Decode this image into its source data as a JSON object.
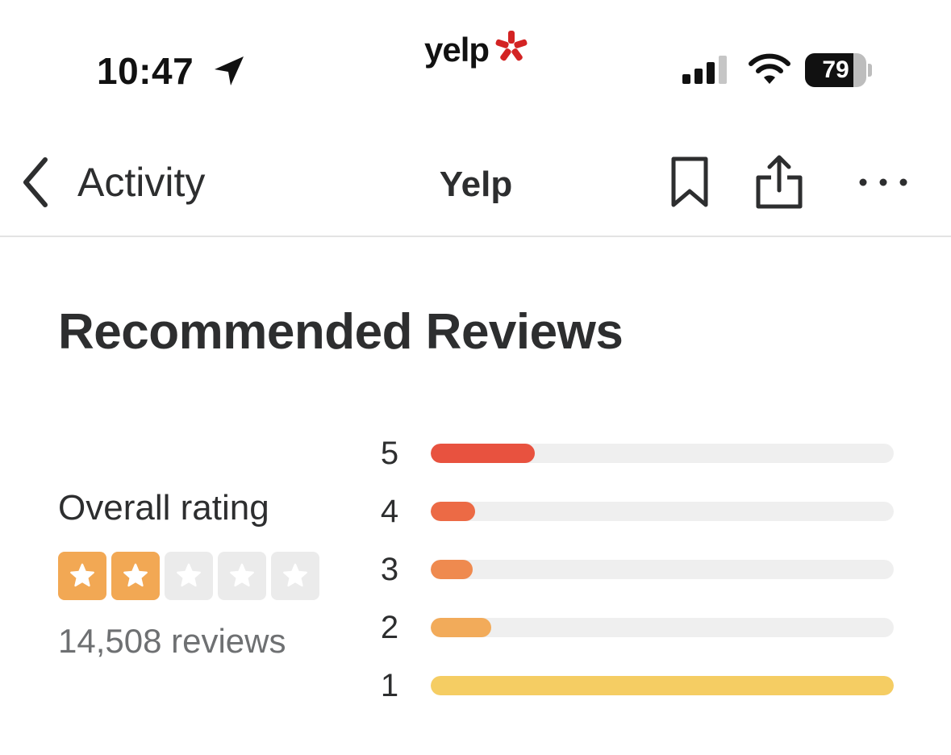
{
  "status_bar": {
    "time": "10:47",
    "battery_level": "79",
    "battery_fraction": 0.79,
    "location_icon": "location-arrow-icon",
    "signal_icon": "cellular-signal-icon",
    "wifi_icon": "wifi-icon"
  },
  "brand": {
    "logo_text": "yelp",
    "logo_icon": "yelp-burst-icon",
    "burst_color": "#d32323"
  },
  "nav": {
    "back_label": "Activity",
    "title": "Yelp",
    "back_icon": "chevron-left-icon",
    "bookmark_icon": "bookmark-icon",
    "share_icon": "share-icon",
    "more_icon": "more-horizontal-icon"
  },
  "reviews": {
    "section_title": "Recommended Reviews",
    "overall_label": "Overall rating",
    "rating": 2,
    "max_rating": 5,
    "review_count": "14,508 reviews",
    "star_filled_color": "#f2a854",
    "star_empty_color": "#ebebeb",
    "breakdown": [
      {
        "stars": "5",
        "fraction": 0.225,
        "color": "#e8523f"
      },
      {
        "stars": "4",
        "fraction": 0.095,
        "color": "#ec6a45"
      },
      {
        "stars": "3",
        "fraction": 0.09,
        "color": "#ef8a4f"
      },
      {
        "stars": "2",
        "fraction": 0.13,
        "color": "#f2ab5a"
      },
      {
        "stars": "1",
        "fraction": 1.0,
        "color": "#f5cd63"
      }
    ]
  }
}
